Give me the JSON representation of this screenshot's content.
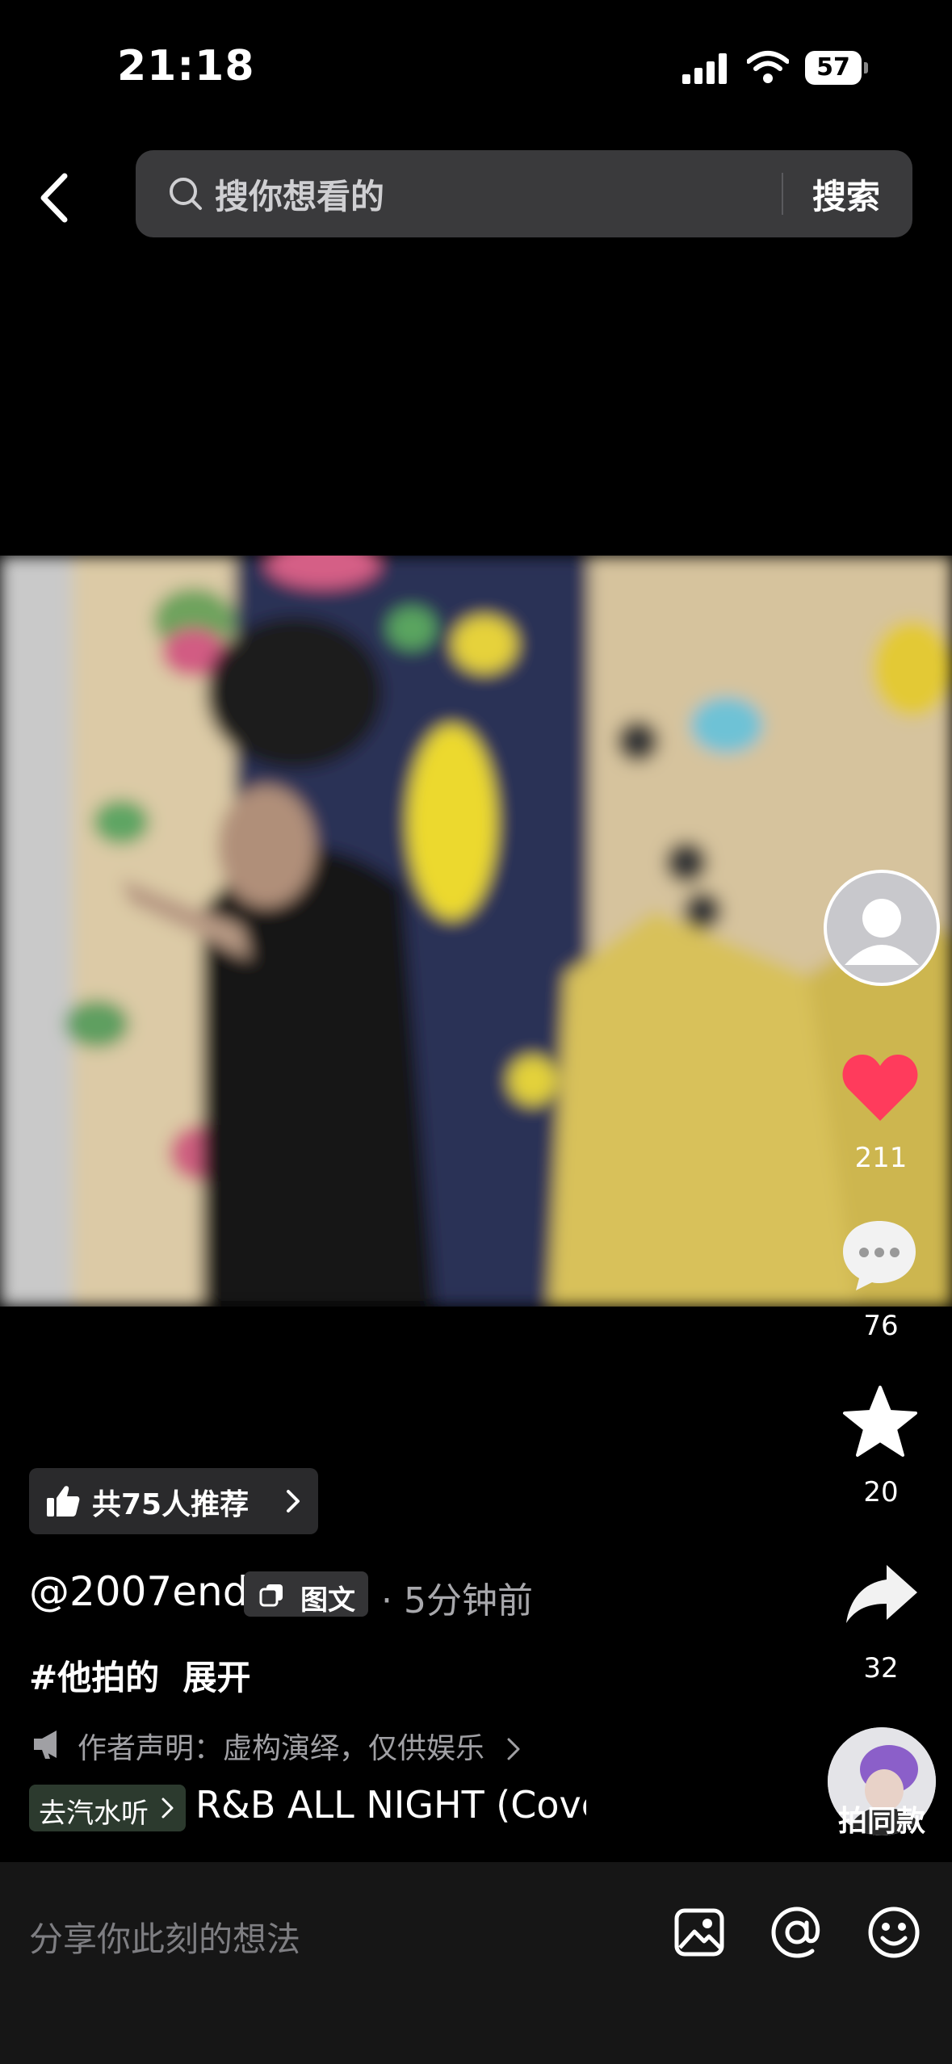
{
  "status_bar": {
    "time": "21:18",
    "battery": "57"
  },
  "search": {
    "placeholder": "搜你想看的",
    "button": "搜索"
  },
  "rail": {
    "likes": "211",
    "comments": "76",
    "favorites": "20",
    "shares": "32",
    "same_style": "拍同款"
  },
  "recommend": {
    "label": "共75人推荐"
  },
  "post": {
    "author": "@2007end",
    "type_chip": "图文",
    "time": "· 5分钟前",
    "hashtag": "#他拍的",
    "expand": "展开",
    "notice": "作者声明：虚构演绎，仅供娱乐",
    "music_link": "去汽水听",
    "music_title": "R&B ALL NIGHT (Cover"
  },
  "comment_bar": {
    "placeholder": "分享你此刻的想法"
  },
  "colors": {
    "like": "#ff3b5c",
    "background": "#000000"
  },
  "icons": [
    "signal-icon",
    "wifi-icon",
    "battery-icon",
    "back-icon",
    "search-icon",
    "heart-icon",
    "comment-icon",
    "star-icon",
    "share-icon",
    "thumbs-up-icon",
    "image-icon",
    "at-icon",
    "emoji-icon"
  ]
}
